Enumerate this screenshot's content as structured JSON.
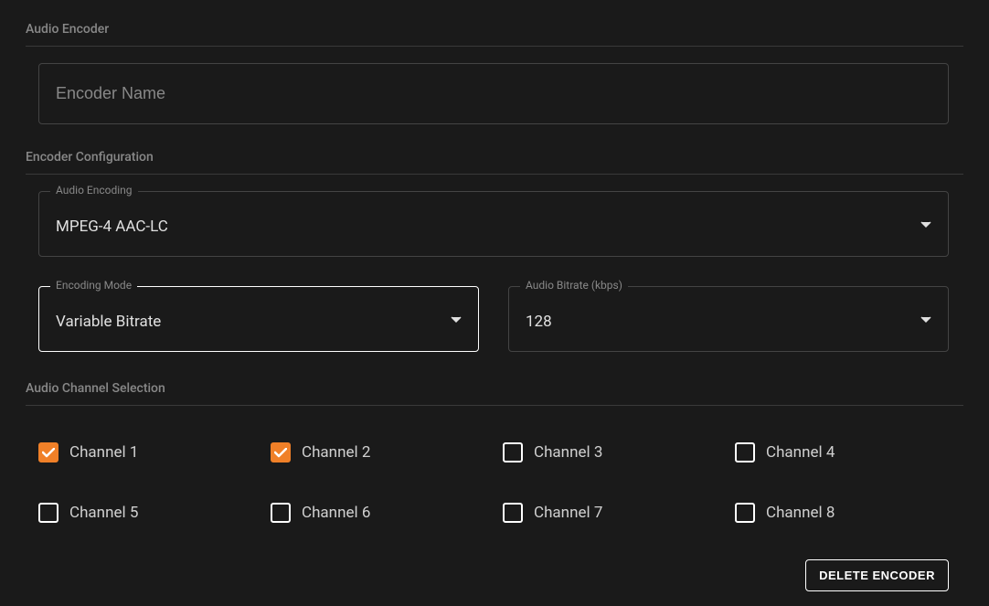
{
  "sections": {
    "audio_encoder": "Audio Encoder",
    "encoder_config": "Encoder Configuration",
    "channel_selection": "Audio Channel Selection"
  },
  "encoder_name": {
    "placeholder": "Encoder Name",
    "value": ""
  },
  "audio_encoding": {
    "label": "Audio Encoding",
    "value": "MPEG-4 AAC-LC"
  },
  "encoding_mode": {
    "label": "Encoding Mode",
    "value": "Variable Bitrate"
  },
  "audio_bitrate": {
    "label": "Audio Bitrate (kbps)",
    "value": "128"
  },
  "channels": [
    {
      "label": "Channel 1",
      "checked": true
    },
    {
      "label": "Channel 2",
      "checked": true
    },
    {
      "label": "Channel 3",
      "checked": false
    },
    {
      "label": "Channel 4",
      "checked": false
    },
    {
      "label": "Channel 5",
      "checked": false
    },
    {
      "label": "Channel 6",
      "checked": false
    },
    {
      "label": "Channel 7",
      "checked": false
    },
    {
      "label": "Channel 8",
      "checked": false
    }
  ],
  "actions": {
    "delete_encoder": "DELETE ENCODER"
  }
}
